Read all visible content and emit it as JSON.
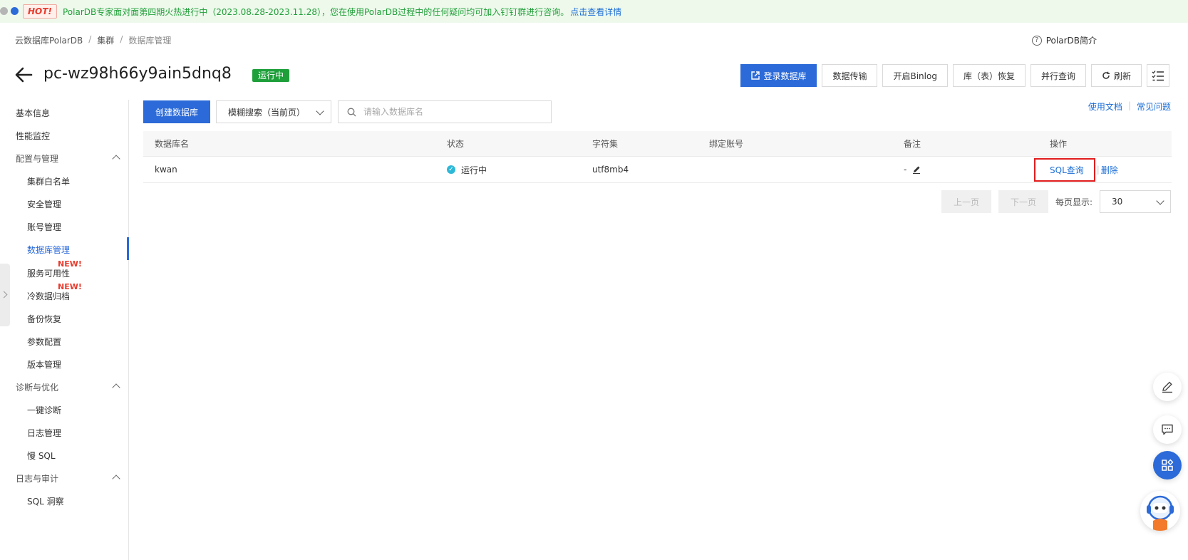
{
  "banner": {
    "hot_label": "HOT!",
    "text": "PolarDB专家面对面第四期火热进行中（2023.08.28-2023.11.28），您在使用PolarDB过程中的任何疑问均可加入钉钉群进行咨询。",
    "link": "点击查看详情"
  },
  "breadcrumb": {
    "items": [
      "云数据库PolarDB",
      "集群",
      "数据库管理"
    ],
    "separator": "/"
  },
  "intro_link": "PolarDB简介",
  "cluster": {
    "id": "pc-wz98h66y9ain5dnq8",
    "status": "运行中"
  },
  "toolbar": {
    "login_db": "登录数据库",
    "data_transfer": "数据传输",
    "binlog": "开启Binlog",
    "restore": "库（表）恢复",
    "parallel_query": "并行查询",
    "refresh": "刷新"
  },
  "sidebar": {
    "basic_info": "基本信息",
    "perf_monitor": "性能监控",
    "config_group": "配置与管理",
    "config_items": [
      "集群白名单",
      "安全管理",
      "账号管理",
      "数据库管理",
      "服务可用性",
      "冷数据归档",
      "备份恢复",
      "参数配置",
      "版本管理"
    ],
    "new_badge": "NEW!",
    "diag_group": "诊断与优化",
    "diag_items": [
      "一键诊断",
      "日志管理",
      "慢 SQL"
    ],
    "audit_group": "日志与审计",
    "audit_items": [
      "SQL 洞察"
    ]
  },
  "controls": {
    "create_db": "创建数据库",
    "search_mode": "模糊搜索（当前页）",
    "search_placeholder": "请输入数据库名",
    "doc_link": "使用文档",
    "faq_link": "常见问题"
  },
  "table": {
    "headers": [
      "数据库名",
      "状态",
      "字符集",
      "绑定账号",
      "备注",
      "操作"
    ],
    "rows": [
      {
        "name": "kwan",
        "status": "运行中",
        "charset": "utf8mb4",
        "account": "",
        "remark": "-",
        "op_sql": "SQL查询",
        "op_delete": "删除"
      }
    ]
  },
  "pagination": {
    "prev": "上一页",
    "next": "下一页",
    "page_size_label": "每页显示:",
    "page_size": "30"
  },
  "colors": {
    "primary": "#2b6ad8",
    "success": "#1e9f3a",
    "highlight": "#e01d1d",
    "banner_bg": "#eef9ec"
  }
}
